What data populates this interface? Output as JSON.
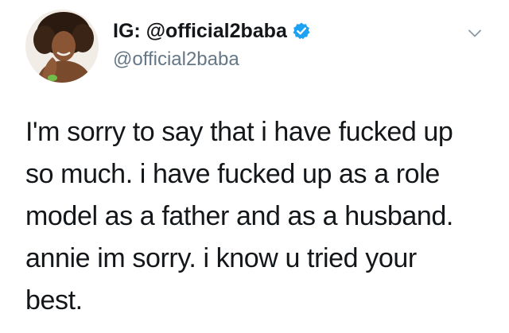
{
  "tweet": {
    "display_name": "IG: @official2baba",
    "handle": "@official2baba",
    "verified": true,
    "body_lines": [
      "I'm sorry to say that i have fucked up",
      "so much. i have fucked up as a role",
      "model as a father and as a husband.",
      "annie im sorry. i know u tried your",
      "best."
    ]
  },
  "icons": {
    "verified": "verified-badge-icon",
    "menu": "chevron-down-icon"
  },
  "colors": {
    "name": "#14171a",
    "handle": "#657786",
    "verified": "#1da1f2",
    "chevron": "#8899a6",
    "background": "#ffffff"
  }
}
